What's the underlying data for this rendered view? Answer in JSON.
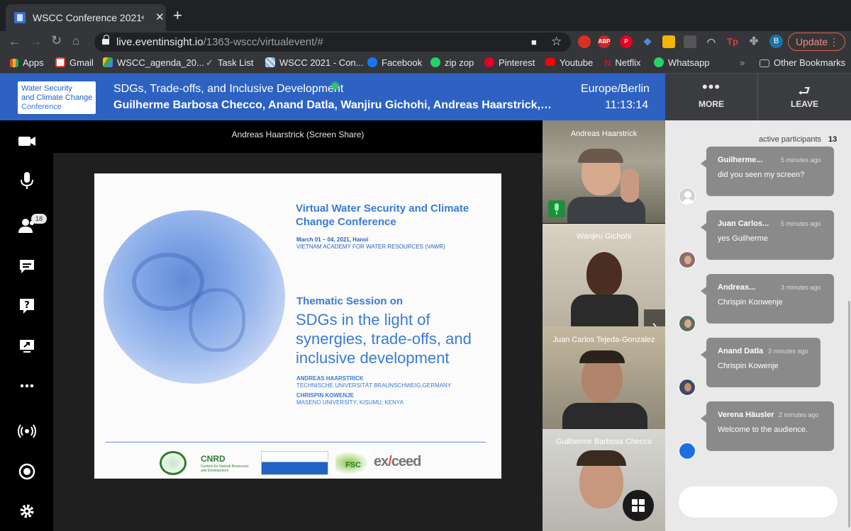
{
  "browser": {
    "tab_title": "WSCC Conference 2021",
    "url_host": "live.eventinsight.io",
    "url_path": "/1363-wscc/virtualevent/#",
    "profile_initial": "B",
    "update_label": "Update",
    "extensions": [
      "ABP"
    ],
    "bookmarks": [
      {
        "label": "Apps",
        "icon": "apps-grid-icon"
      },
      {
        "label": "Gmail",
        "icon": "gmail-icon"
      },
      {
        "label": "WSCC_agenda_20...",
        "icon": "drive-icon"
      },
      {
        "label": "Task List",
        "icon": "checkmark-icon"
      },
      {
        "label": "WSCC 2021 - Con...",
        "icon": "site-icon"
      },
      {
        "label": "Facebook",
        "icon": "facebook-icon"
      },
      {
        "label": "zip zop",
        "icon": "whatsapp-icon"
      },
      {
        "label": "Pinterest",
        "icon": "pinterest-icon"
      },
      {
        "label": "Youtube",
        "icon": "youtube-icon"
      },
      {
        "label": "Netflix",
        "icon": "netflix-icon"
      },
      {
        "label": "Whatsapp",
        "icon": "whatsapp-icon"
      }
    ],
    "other_bookmarks": "Other Bookmarks"
  },
  "header": {
    "logo_line1": "Water Security",
    "logo_line2": "and Climate Change",
    "logo_line3": "Conference",
    "session_title": "SDGs, Trade-offs, and Inclusive Development",
    "speakers": "Guilherme Barbosa Checco, Anand Datla, Wanjiru Gichohi, Andreas Haarstrick,…",
    "timezone": "Europe/Berlin",
    "time": "11:13:14",
    "more_label": "MORE",
    "leave_label": "LEAVE"
  },
  "toolbar": {
    "participants_count": "18"
  },
  "stage": {
    "share_label": "Andreas Haarstrick (Screen Share)",
    "slide": {
      "title_line1": "Virtual Water Security and Climate",
      "title_line2": "Change Conference",
      "date": "March 01 – 04, 2021, Hanoi",
      "venue": "VIETNAM ACADEMY FOR WATER RESOURCES (VAWR)",
      "thematic": "Thematic Session on",
      "big_line1": "SDGs in the light of",
      "big_line2": "synergies, trade-offs, and",
      "big_line3": "inclusive development",
      "author1": "ANDREAS HAARSTRICK",
      "affil1": "TECHNISCHE UNIVERSITÄT BRAUNSCHWEIG,GERMANY",
      "author2": "CHRISPIN KOWENJE",
      "affil2": "MASENO UNIVERSITY; KISUMU; KENYA",
      "cnrd": "CNRD",
      "cnrd_sub1": "Centers for Natural Resources",
      "cnrd_sub2": "and Development",
      "exceed_left": "ex",
      "exceed_right": "ceed",
      "fsc": "FSC"
    }
  },
  "videos": [
    {
      "name": "Andreas Haarstrick"
    },
    {
      "name": "Wanjiru Gichohi"
    },
    {
      "name": "Juan Carlos Tejeda-Gonzalez"
    },
    {
      "name": "Guilherme Barbosa Checco"
    }
  ],
  "chat": {
    "active_label": "active participants",
    "active_count": "13",
    "messages": [
      {
        "name": "Guilherme...",
        "time": "5 minutes ago",
        "text": "did you seen my screen?"
      },
      {
        "name": "Juan Carlos...",
        "time": "5 minutes ago",
        "text": "yes Guilherme"
      },
      {
        "name": "Andreas...",
        "time": "3 minutes ago",
        "text": "Chrispin Konwenje"
      },
      {
        "name": "Anand Datla",
        "time": "3 minutes ago",
        "text": "Chrispin Kowenje"
      },
      {
        "name": "Verena Häusler",
        "time": "2 minutes ago",
        "text": "Welcome to the audience."
      }
    ]
  },
  "colors": {
    "header_blue": "#2d62c2",
    "slide_blue": "#3a7bd5",
    "live_green": "#34c759"
  }
}
